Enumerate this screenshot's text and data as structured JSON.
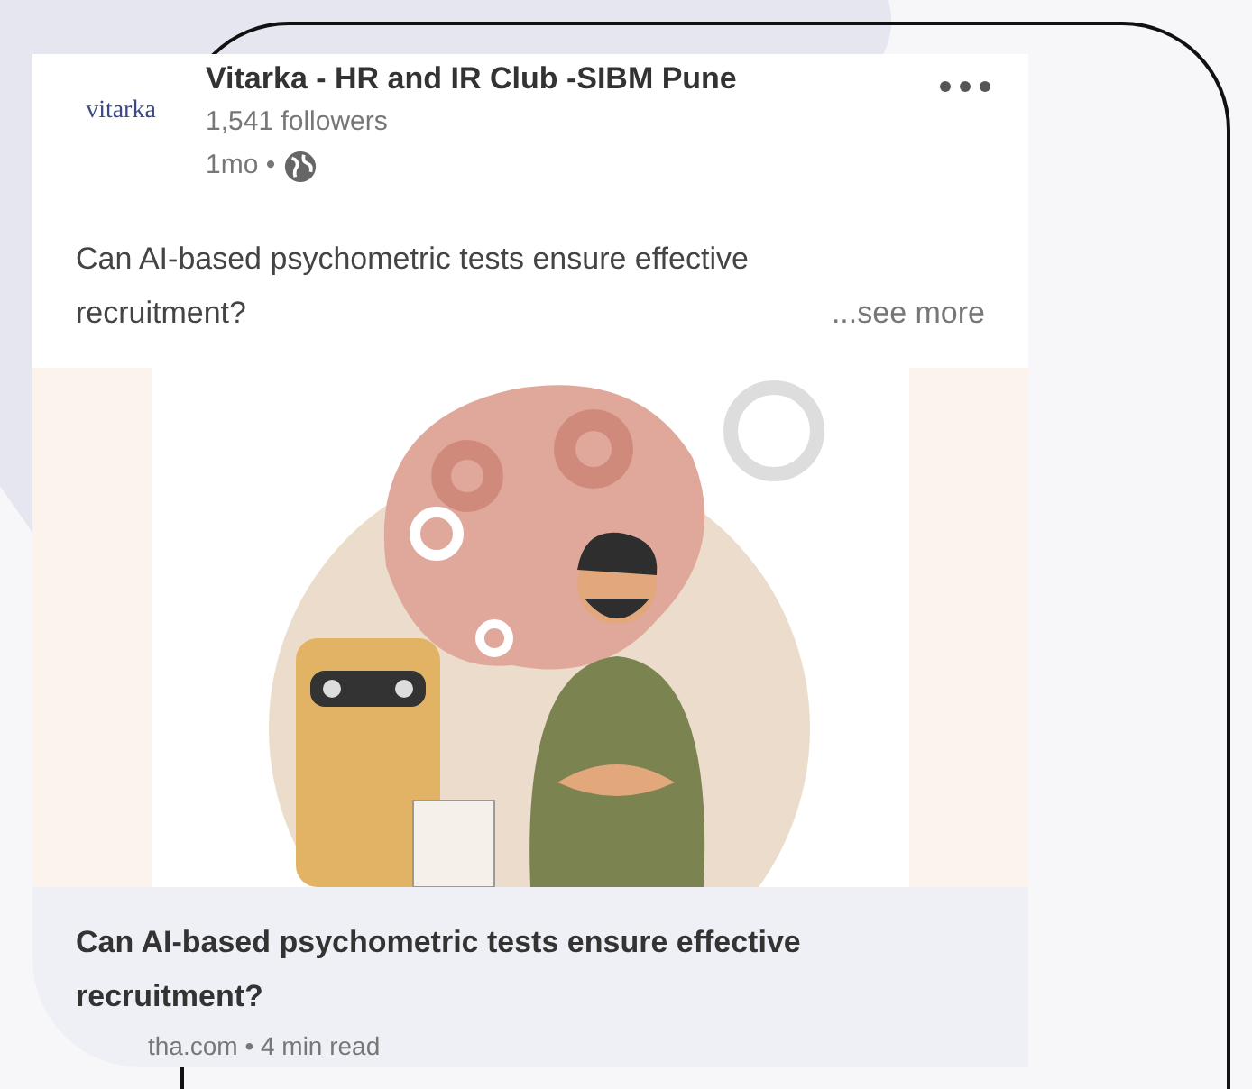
{
  "post": {
    "author": "Vitarka - HR and IR Club -SIBM Pune",
    "logo_text": "vitarka",
    "followers": "1,541 followers",
    "time": "1mo •",
    "text": "Can AI-based psychometric tests ensure effective recruitment?",
    "see_more": "...see more"
  },
  "article": {
    "headline": "Can AI-based psychometric tests ensure effective recruitment?",
    "source": "tha.com • 4 min read"
  }
}
